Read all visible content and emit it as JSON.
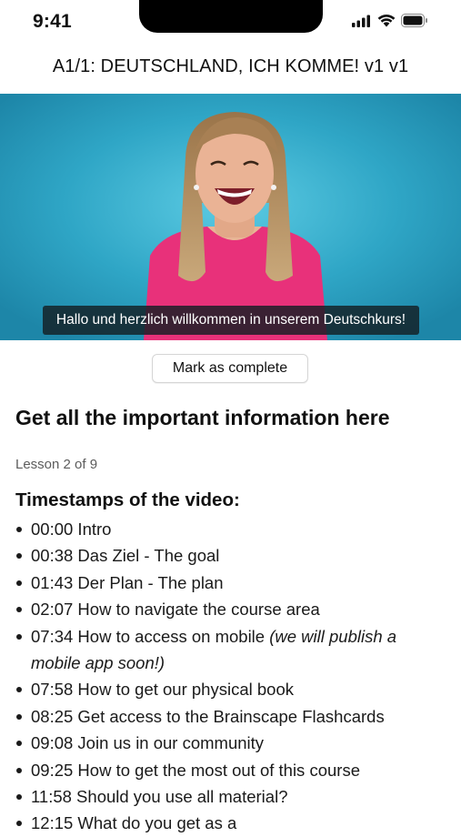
{
  "status_bar": {
    "time": "9:41"
  },
  "header": {
    "title": "A1/1: DEUTSCHLAND, ICH KOMME! v1 v1"
  },
  "video": {
    "subtitle": "Hallo und herzlich willkommen in unserem Deutschkurs!"
  },
  "actions": {
    "mark_complete_label": "Mark as complete"
  },
  "content": {
    "heading": "Get all the important information here",
    "lesson_counter": "Lesson 2 of 9",
    "timestamps_heading": "Timestamps of the video:",
    "timestamps": [
      {
        "text": "00:00 Intro",
        "note": ""
      },
      {
        "text": "00:38 Das Ziel - The goal",
        "note": ""
      },
      {
        "text": "01:43 Der Plan - The plan",
        "note": ""
      },
      {
        "text": "02:07 How to navigate the course area",
        "note": ""
      },
      {
        "text": "07:34 How to access on mobile ",
        "note": "(we will publish a mobile app soon!)"
      },
      {
        "text": "07:58 How to get our physical book",
        "note": ""
      },
      {
        "text": "08:25 Get access to the Brainscape Flashcards",
        "note": ""
      },
      {
        "text": "09:08 Join us in our community",
        "note": ""
      },
      {
        "text": "09:25 How to get the most out of this course",
        "note": ""
      },
      {
        "text": "11:58 Should you use all material?",
        "note": ""
      },
      {
        "text": "12:15 What do you get as a ",
        "note": ""
      }
    ]
  },
  "colors": {
    "video_background": "#30a9c9",
    "shirt": "#e8317a",
    "text": "#111111",
    "muted_text": "#5c5c5c"
  }
}
